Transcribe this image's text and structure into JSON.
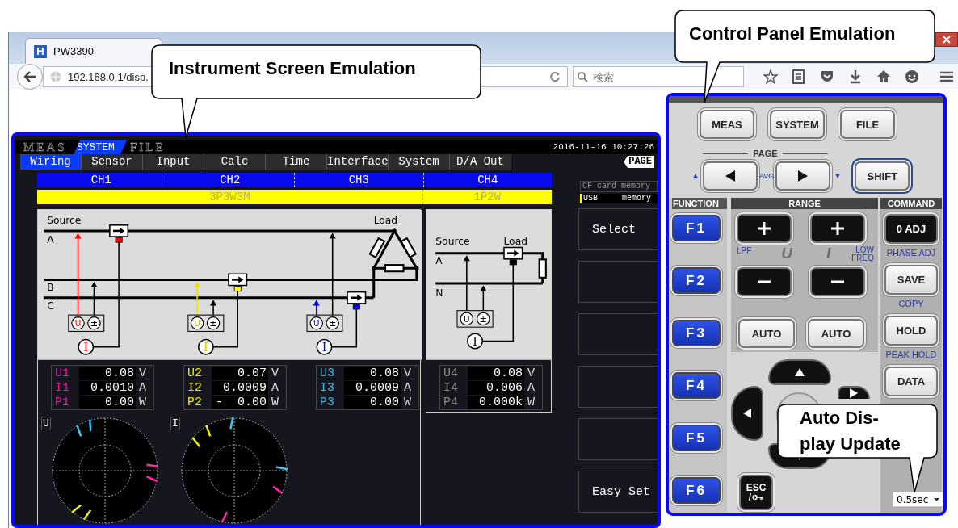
{
  "browser": {
    "tab_title": "PW3390",
    "favicon_letter": "H",
    "url": "192.168.0.1/disp.",
    "search": {
      "placeholder": "検索"
    }
  },
  "instrument": {
    "modes": [
      {
        "label": "MEAS",
        "selected": false
      },
      {
        "label": "SYSTEM",
        "selected": true
      },
      {
        "label": "FILE",
        "selected": false
      }
    ],
    "datetime": "2016-11-16 10:27:26",
    "tabs": [
      {
        "label": "Wiring",
        "selected": true
      },
      {
        "label": "Sensor",
        "selected": false
      },
      {
        "label": "Input",
        "selected": false
      },
      {
        "label": "Calc",
        "selected": false
      },
      {
        "label": "Time",
        "selected": false
      },
      {
        "label": "Interface",
        "selected": false
      },
      {
        "label": "System",
        "selected": false
      },
      {
        "label": "D/A Out",
        "selected": false
      }
    ],
    "page_label": "PAGE",
    "storage": [
      {
        "label": "CF card memory",
        "selected": false
      },
      {
        "label": "USB memory",
        "selected": true
      }
    ],
    "systems": [
      {
        "wiring": "3P3W3M",
        "channels": [
          "CH1",
          "CH2",
          "CH3"
        ],
        "diagram": {
          "kind": "delta",
          "source": "Source",
          "load": "Load",
          "lines": [
            {
              "label": "A"
            },
            {
              "label": "B"
            },
            {
              "label": "C"
            }
          ],
          "probes": [
            {
              "color": "#ff0000",
              "voltage": "U",
              "common": "±",
              "current": "I"
            },
            {
              "color": "#ffff00",
              "voltage": "U",
              "common": "±",
              "current": "I"
            },
            {
              "color": "#0000ff",
              "voltage": "U",
              "common": "±",
              "current": "I"
            }
          ]
        },
        "readings": [
          {
            "color": "#e0189a",
            "rows": [
              {
                "label": "U1",
                "value": "0.08",
                "unit": "V"
              },
              {
                "label": "I1",
                "value": "0.0010",
                "unit": "A"
              },
              {
                "label": "P1",
                "value": "0.00",
                "unit": "W"
              }
            ]
          },
          {
            "color": "#f0f000",
            "rows": [
              {
                "label": "U2",
                "value": "0.07",
                "unit": "V"
              },
              {
                "label": "I2",
                "value": "0.0009",
                "unit": "A"
              },
              {
                "label": "P2",
                "value": "-  0.00",
                "unit": "W"
              }
            ]
          },
          {
            "color": "#40b8e8",
            "rows": [
              {
                "label": "U3",
                "value": "0.08",
                "unit": "V"
              },
              {
                "label": "I3",
                "value": "0.0009",
                "unit": "A"
              },
              {
                "label": "P3",
                "value": "0.00",
                "unit": "W"
              }
            ]
          }
        ],
        "phasors": [
          {
            "label": "U"
          },
          {
            "label": "I"
          }
        ]
      },
      {
        "wiring": "1P2W",
        "channels": [
          "CH4"
        ],
        "diagram": {
          "kind": "single",
          "source": "Source",
          "load": "Load",
          "lines": [
            {
              "label": "A"
            },
            {
              "label": "N"
            }
          ],
          "probes": [
            {
              "color": "#000000",
              "voltage": "U",
              "common": "±",
              "current": "I"
            }
          ]
        },
        "readings": [
          {
            "color": "#8a8a8a",
            "rows": [
              {
                "label": "U4",
                "value": "0.08",
                "unit": "V"
              },
              {
                "label": "I4",
                "value": "0.006",
                "unit": "A"
              },
              {
                "label": "P4",
                "value": "0.000k",
                "unit": "W"
              }
            ]
          }
        ]
      }
    ],
    "soft_keys": [
      {
        "kind": "labeled",
        "label": "Select"
      },
      {
        "kind": "blank"
      },
      {
        "kind": "blank"
      },
      {
        "kind": "blank"
      },
      {
        "kind": "blank"
      },
      {
        "kind": "labeled",
        "label": "Easy Set"
      }
    ]
  },
  "control_panel": {
    "menu_keys": [
      {
        "label": "MEAS"
      },
      {
        "label": "SYSTEM"
      },
      {
        "label": "FILE"
      }
    ],
    "page_label": "PAGE",
    "avg_label": "AVG",
    "shift_key": "SHIFT",
    "function": {
      "title": "FUNCTION",
      "keys": [
        {
          "label": "F1"
        },
        {
          "label": "F2"
        },
        {
          "label": "F3"
        },
        {
          "label": "F4"
        },
        {
          "label": "F5"
        },
        {
          "label": "F6"
        }
      ]
    },
    "range": {
      "title": "RANGE",
      "lpf": "LPF",
      "u_label": "U",
      "i_label": "I",
      "low_freq": "LOW\nFREQ",
      "auto_keys": [
        {
          "label": "AUTO"
        },
        {
          "label": "AUTO"
        }
      ]
    },
    "command": {
      "title": "COMMAND",
      "keys": [
        {
          "kind": "dark",
          "label": "0 ADJ",
          "sub": "PHASE ADJ"
        },
        {
          "kind": "light",
          "label": "SAVE",
          "sub": "COPY"
        },
        {
          "kind": "light",
          "label": "HOLD",
          "sub": "PEAK HOLD"
        },
        {
          "kind": "light",
          "label": "DATA"
        }
      ]
    },
    "esc_key": {
      "label": "ESC",
      "sub": "/"
    },
    "update": {
      "value": "0.5sec"
    }
  },
  "callouts": [
    {
      "text": "Instrument Screen Emulation"
    },
    {
      "text": "Control Panel Emulation"
    },
    {
      "text": "Auto Dis-\nplay Update"
    }
  ]
}
